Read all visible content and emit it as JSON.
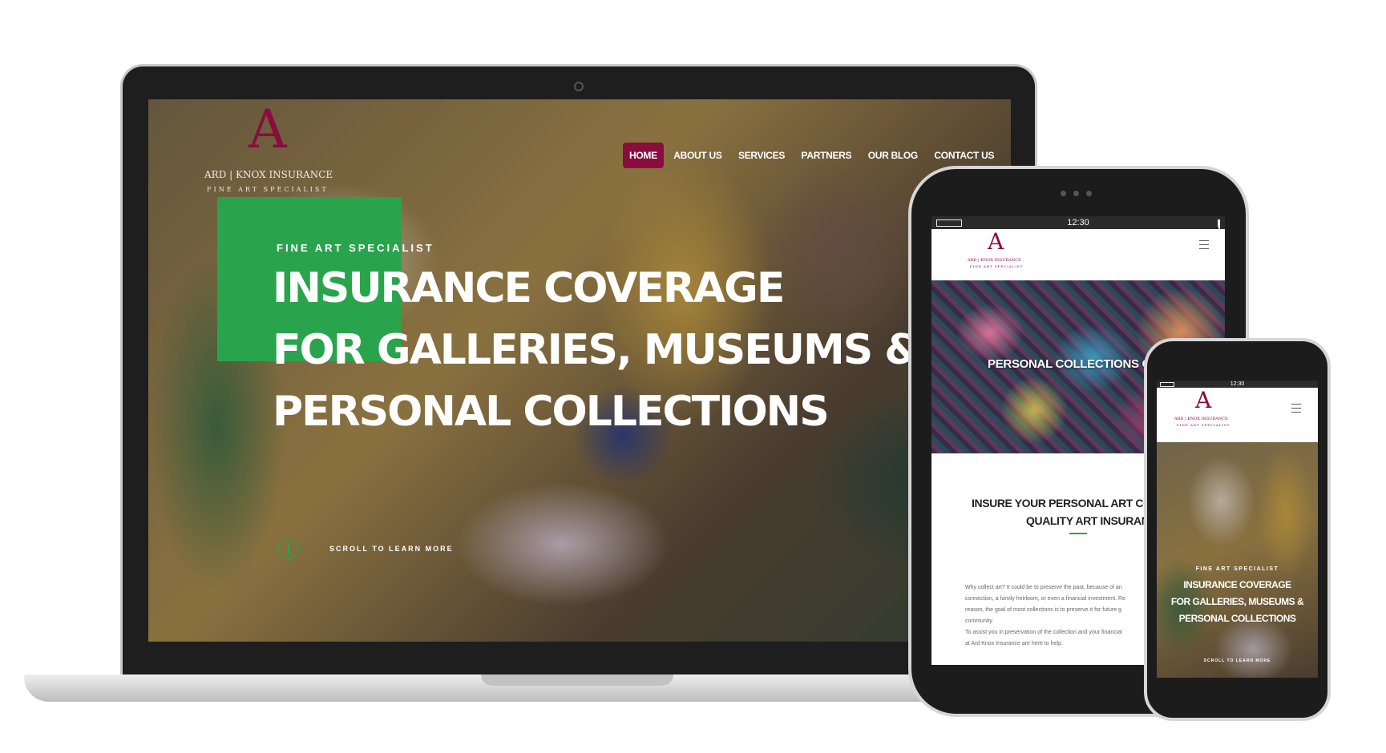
{
  "brand": {
    "logo_letter": "A",
    "name": "ARD | KNOX INSURANCE",
    "tagline": "FINE ART SPECIALIST",
    "accent": "#8a0c3e",
    "green": "#2aa44c"
  },
  "nav": {
    "items": [
      {
        "label": "HOME",
        "active": true
      },
      {
        "label": "ABOUT US",
        "active": false
      },
      {
        "label": "SERVICES",
        "active": false
      },
      {
        "label": "PARTNERS",
        "active": false
      },
      {
        "label": "OUR BLOG",
        "active": false
      },
      {
        "label": "CONTACT US",
        "active": false
      }
    ]
  },
  "hero": {
    "kicker": "FINE ART SPECIALIST",
    "line1": "INSURANCE COVERAGE",
    "line2": "FOR GALLERIES, MUSEUMS &",
    "line3": "PERSONAL COLLECTIONS",
    "scroll_label": "SCROLL TO LEARN MORE"
  },
  "tablet": {
    "status_time": "12:30",
    "logo_name": "ARD | KNOX INSURANCE",
    "logo_tagline": "FINE ART SPECIALIST",
    "banner_text": "PERSONAL COLLECTIONS COV",
    "section_title_1": "INSURE YOUR PERSONAL ART COLLE",
    "section_title_2": "QUALITY ART INSURANCE",
    "body_1": "Why collect art? It could be to preserve the past, because of an",
    "body_2": "connection, a family heirloom, or even a financial investment. Re",
    "body_3": "reason, the goal of most collections is to preserve it for future g",
    "body_4": "community.",
    "body_5": "To assist you in preservation of the collection and your financial",
    "body_6": "at Ard Knox Insurance are here to help."
  },
  "phone": {
    "status_time": "12:30",
    "logo_name": "ARD | KNOX INSURANCE",
    "logo_tagline": "FINE ART SPECIALIST",
    "kicker": "FINE ART SPECIALIST",
    "line1": "INSURANCE COVERAGE",
    "line2": "FOR GALLERIES, MUSEUMS &",
    "line3": "PERSONAL COLLECTIONS",
    "scroll_label": "SCROLL TO LEARN MORE"
  }
}
